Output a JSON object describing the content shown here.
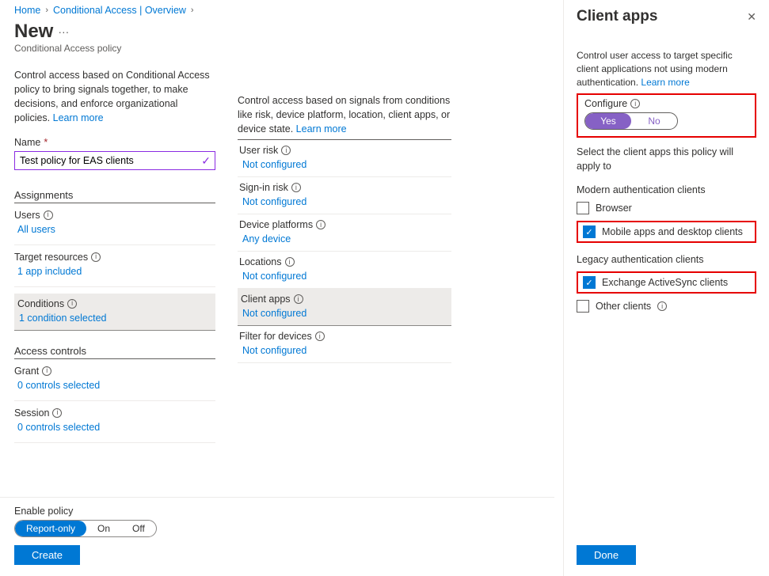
{
  "breadcrumb": {
    "home": "Home",
    "item1": "Conditional Access | Overview"
  },
  "page": {
    "title": "New",
    "dots": "···",
    "subtitle": "Conditional Access policy"
  },
  "left": {
    "intro": "Control access based on Conditional Access policy to bring signals together, to make decisions, and enforce organizational policies.",
    "learn_more": "Learn more",
    "name_label": "Name",
    "name_value": "Test policy for EAS clients",
    "assignments_head": "Assignments",
    "users_label": "Users",
    "users_value": "All users",
    "target_label": "Target resources",
    "target_value": "1 app included",
    "cond_label": "Conditions",
    "cond_value": "1 condition selected",
    "access_head": "Access controls",
    "grant_label": "Grant",
    "grant_value": "0 controls selected",
    "session_label": "Session",
    "session_value": "0 controls selected"
  },
  "mid": {
    "intro": "Control access based on signals from conditions like risk, device platform, location, client apps, or device state.",
    "learn_more": "Learn more",
    "items": [
      {
        "label": "User risk",
        "value": "Not configured",
        "selected": false,
        "box": false
      },
      {
        "label": "Sign-in risk",
        "value": "Not configured",
        "selected": false,
        "box": false
      },
      {
        "label": "Device platforms",
        "value": "Any device",
        "selected": false,
        "box": false
      },
      {
        "label": "Locations",
        "value": "Not configured",
        "selected": false,
        "box": false
      },
      {
        "label": "Client apps",
        "value": "Not configured",
        "selected": true,
        "box": false
      },
      {
        "label": "Filter for devices",
        "value": "Not configured",
        "selected": false,
        "box": false
      }
    ]
  },
  "bottom": {
    "enable_label": "Enable policy",
    "opts": [
      "Report-only",
      "On",
      "Off"
    ],
    "create": "Create"
  },
  "panel": {
    "title": "Client apps",
    "desc": "Control user access to target specific client applications not using modern authentication.",
    "learn_more": "Learn more",
    "configure_label": "Configure",
    "yes": "Yes",
    "no": "No",
    "select_text": "Select the client apps this policy will apply to",
    "group1": "Modern authentication clients",
    "chk_browser": "Browser",
    "chk_mobile": "Mobile apps and desktop clients",
    "group2": "Legacy authentication clients",
    "chk_eas": "Exchange ActiveSync clients",
    "chk_other": "Other clients",
    "done": "Done"
  }
}
